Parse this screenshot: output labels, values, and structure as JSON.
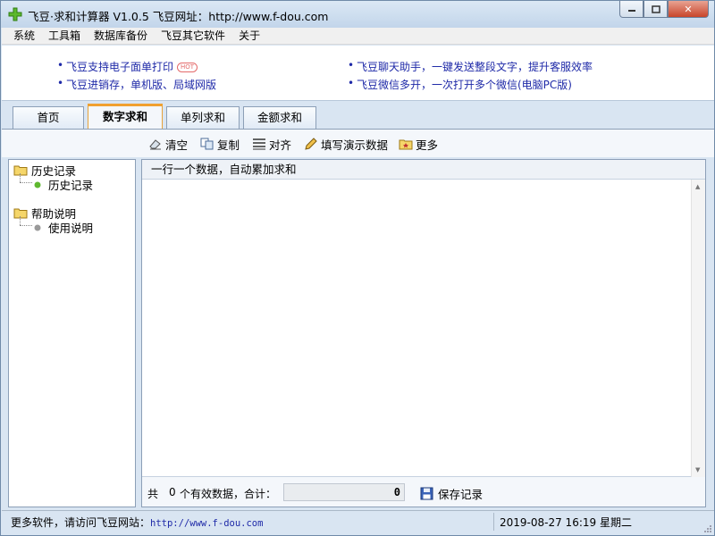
{
  "window": {
    "title": "飞豆·求和计算器 V1.0.5  飞豆网址：http://www.f-dou.com",
    "min_label": "▭",
    "max_label": "▢",
    "close_label": "✕"
  },
  "menu": {
    "items": [
      "系统",
      "工具箱",
      "数据库备份",
      "飞豆其它软件",
      "关于"
    ]
  },
  "ads": {
    "left": [
      "飞豆支持电子面单打印",
      "飞豆进销存，单机版、局域网版"
    ],
    "left_badge": "HOT",
    "right": [
      "飞豆聊天助手，一键发送整段文字，提升客服效率",
      "飞豆微信多开，一次打开多个微信(电脑PC版)"
    ]
  },
  "tabs": {
    "items": [
      "首页",
      "数字求和",
      "单列求和",
      "金额求和"
    ],
    "active": "数字求和"
  },
  "toolbar": {
    "clear": "清空",
    "copy": "复制",
    "align": "对齐",
    "demo": "填写演示数据",
    "more": "更多"
  },
  "tree": {
    "history_folder": "历史记录",
    "history_item": "历史记录",
    "help_folder": "帮助说明",
    "help_item": "使用说明",
    "history_dot_color": "#5fb82f",
    "help_dot_color": "#9a9a9a"
  },
  "content": {
    "header": "一行一个数据，自动累加求和",
    "count_prefix": "共",
    "count": "0",
    "count_suffix": "个有效数据，合计：",
    "total": "0",
    "save": "保存记录"
  },
  "status": {
    "left_text": "更多软件，请访问飞豆网站：",
    "url": "http://www.f-dou.com",
    "datetime": "2019-08-27 16:19 星期二"
  }
}
